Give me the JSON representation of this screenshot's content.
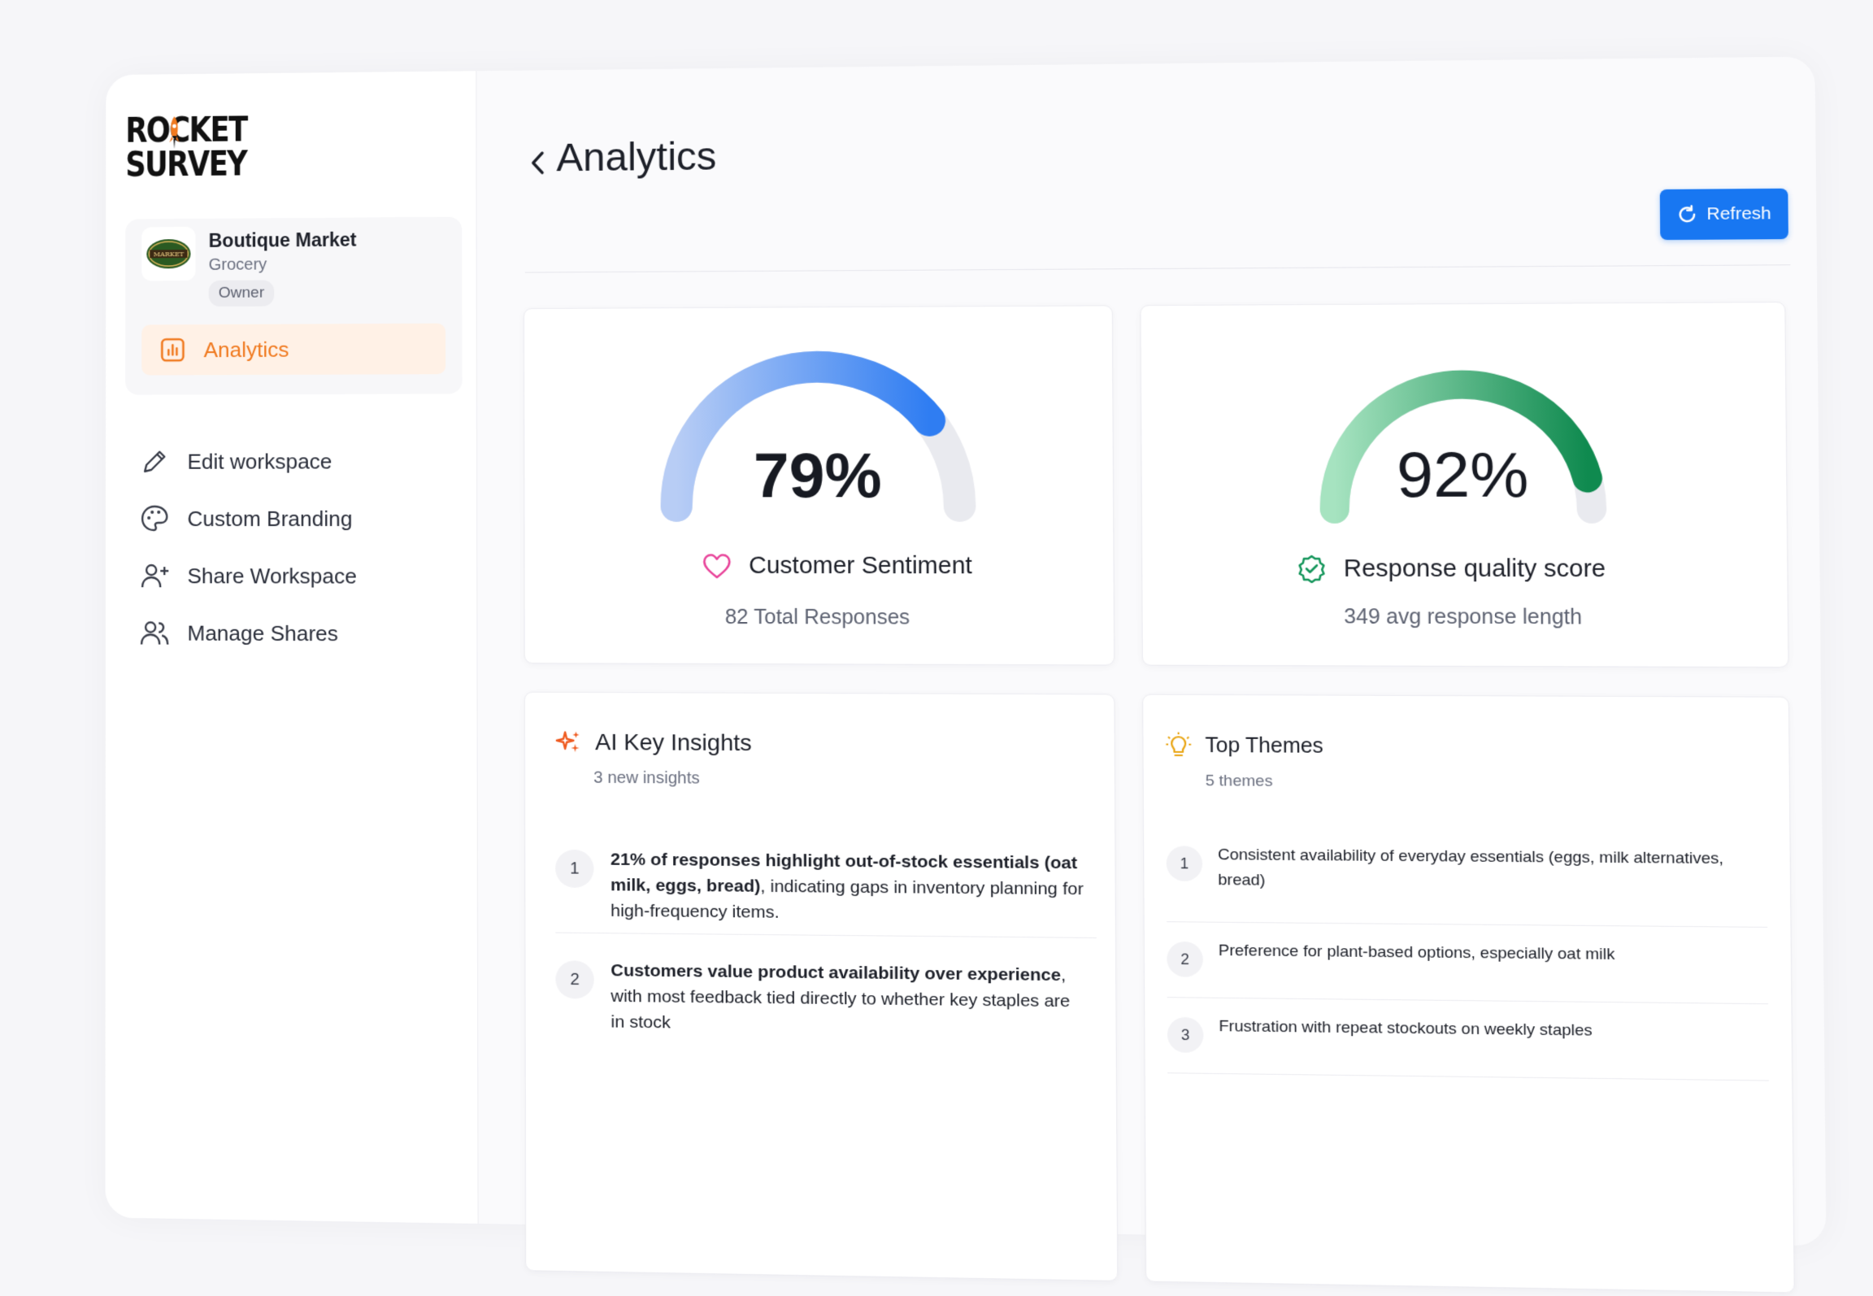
{
  "brand": {
    "line1": "ROCKET",
    "line2": "SURVEY"
  },
  "workspace": {
    "name": "Boutique Market",
    "type": "Grocery",
    "role": "Owner",
    "logo_text": "MARKET"
  },
  "sidebar": {
    "active": "Analytics",
    "items": [
      {
        "label": "Edit workspace",
        "icon": "pencil-icon"
      },
      {
        "label": "Custom Branding",
        "icon": "palette-icon"
      },
      {
        "label": "Share Workspace",
        "icon": "user-plus-icon"
      },
      {
        "label": "Manage Shares",
        "icon": "users-icon"
      }
    ]
  },
  "header": {
    "title": "Analytics",
    "refresh_label": "Refresh"
  },
  "metrics": {
    "sentiment": {
      "value": "79%",
      "fraction": 0.79,
      "label": "Customer Sentiment",
      "sub": "82 Total Responses"
    },
    "quality": {
      "value": "92%",
      "fraction": 0.92,
      "label": "Response quality score",
      "sub": "349 avg response length"
    }
  },
  "insights": {
    "title": "AI Key Insights",
    "subtitle": "3 new insights",
    "items": [
      {
        "num": "1",
        "bold": "21% of responses highlight out-of-stock essentials (oat milk, eggs, bread)",
        "rest": ", indicating gaps in inventory planning for high-frequency items."
      },
      {
        "num": "2",
        "bold": "Customers value product availability over experience",
        "rest": ", with most feedback tied directly to whether key staples are in stock"
      }
    ]
  },
  "themes": {
    "title": "Top Themes",
    "subtitle": "5 themes",
    "items": [
      {
        "num": "1",
        "text": "Consistent availability of everyday essentials (eggs, milk alternatives, bread)"
      },
      {
        "num": "2",
        "text": "Preference for plant-based options, especially oat milk"
      },
      {
        "num": "3",
        "text": "Frustration with repeat stockouts on weekly staples"
      }
    ]
  },
  "colors": {
    "accent": "#1877f2",
    "active_nav": "#f07a20",
    "sentiment_start": "#b8cdf5",
    "sentiment_end": "#2f7df2",
    "quality_start": "#a6e3c0",
    "quality_end": "#0f8a4f",
    "track": "#e9eaef"
  }
}
